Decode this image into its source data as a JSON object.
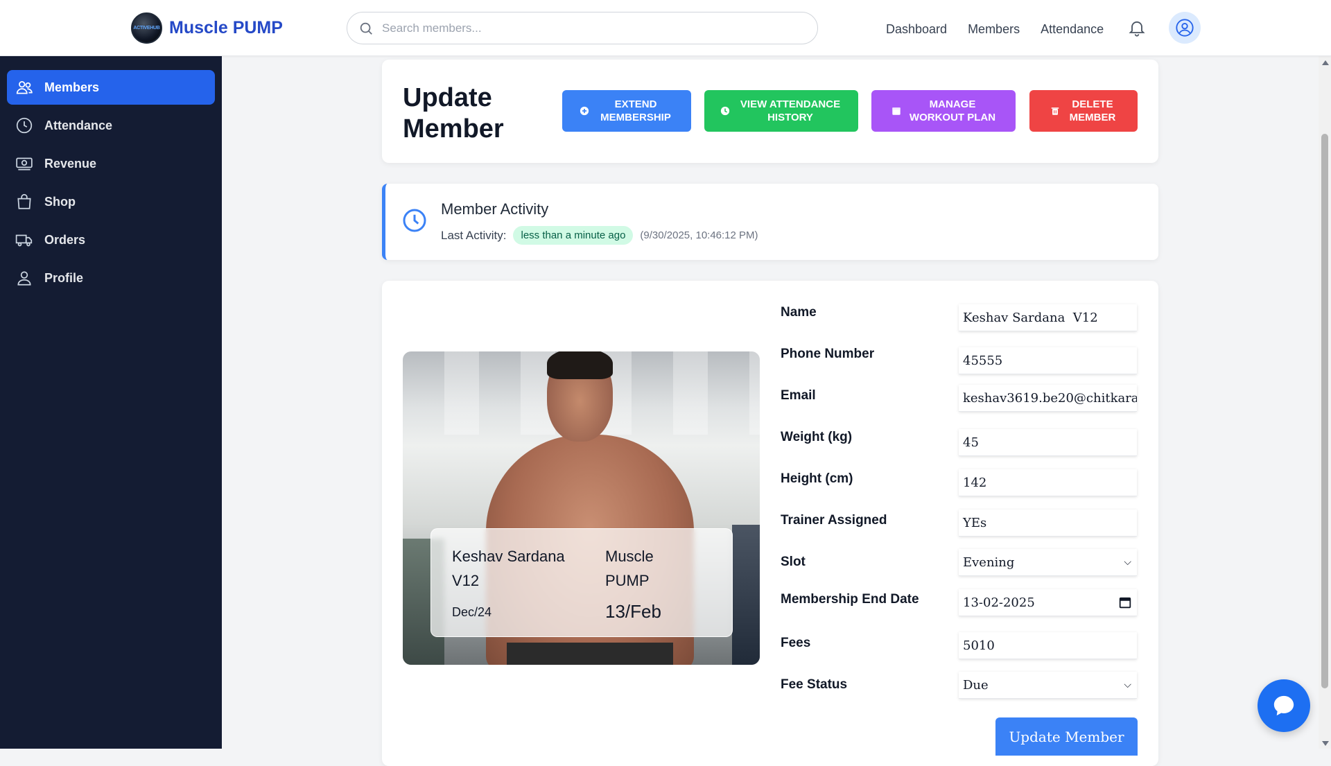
{
  "header": {
    "app_name": "Muscle PUMP",
    "logo_text": "ACTIVEHUB",
    "search_placeholder": "Search members...",
    "nav": [
      "Dashboard",
      "Members",
      "Attendance"
    ]
  },
  "sidebar": {
    "items": [
      {
        "label": "Members",
        "icon": "users-icon",
        "active": true
      },
      {
        "label": "Attendance",
        "icon": "clock-icon",
        "active": false
      },
      {
        "label": "Revenue",
        "icon": "money-icon",
        "active": false
      },
      {
        "label": "Shop",
        "icon": "shopping-bag-icon",
        "active": false
      },
      {
        "label": "Orders",
        "icon": "truck-icon",
        "active": false
      },
      {
        "label": "Profile",
        "icon": "user-icon",
        "active": false
      }
    ]
  },
  "page": {
    "title": "Update Member",
    "actions": {
      "extend": "EXTEND MEMBERSHIP",
      "attendance": "VIEW ATTENDANCE HISTORY",
      "workout": "MANAGE WORKOUT PLAN",
      "delete": "DELETE MEMBER"
    }
  },
  "activity": {
    "title": "Member Activity",
    "label": "Last Activity:",
    "relative": "less than a minute ago",
    "timestamp": "(9/30/2025, 10:46:12 PM)"
  },
  "member_card": {
    "name": "Keshav Sardana V12",
    "gym": "Muscle PUMP",
    "joined": "Dec/24",
    "end": "13/Feb"
  },
  "form": {
    "fields": [
      {
        "label": "Name",
        "value": "Keshav Sardana  V12"
      },
      {
        "label": "Phone Number",
        "value": "45555"
      },
      {
        "label": "Email",
        "value": "keshav3619.be20@chitkara."
      },
      {
        "label": "Weight (kg)",
        "value": "45"
      },
      {
        "label": "Height (cm)",
        "value": "142"
      },
      {
        "label": "Trainer Assigned",
        "value": "YEs"
      },
      {
        "label": "Slot",
        "value": "Evening"
      },
      {
        "label": "Membership End Date",
        "value": "13-02-2025"
      },
      {
        "label": "Fees",
        "value": "5010"
      },
      {
        "label": "Fee Status",
        "value": "Due"
      }
    ],
    "submit": "Update Member"
  },
  "colors": {
    "brand": "#2549c7",
    "sidebar_bg": "#141c33",
    "active": "#2563eb",
    "extend": "#3b82f6",
    "attendance": "#22c55e",
    "workout": "#a855f7",
    "delete": "#ef4444"
  }
}
